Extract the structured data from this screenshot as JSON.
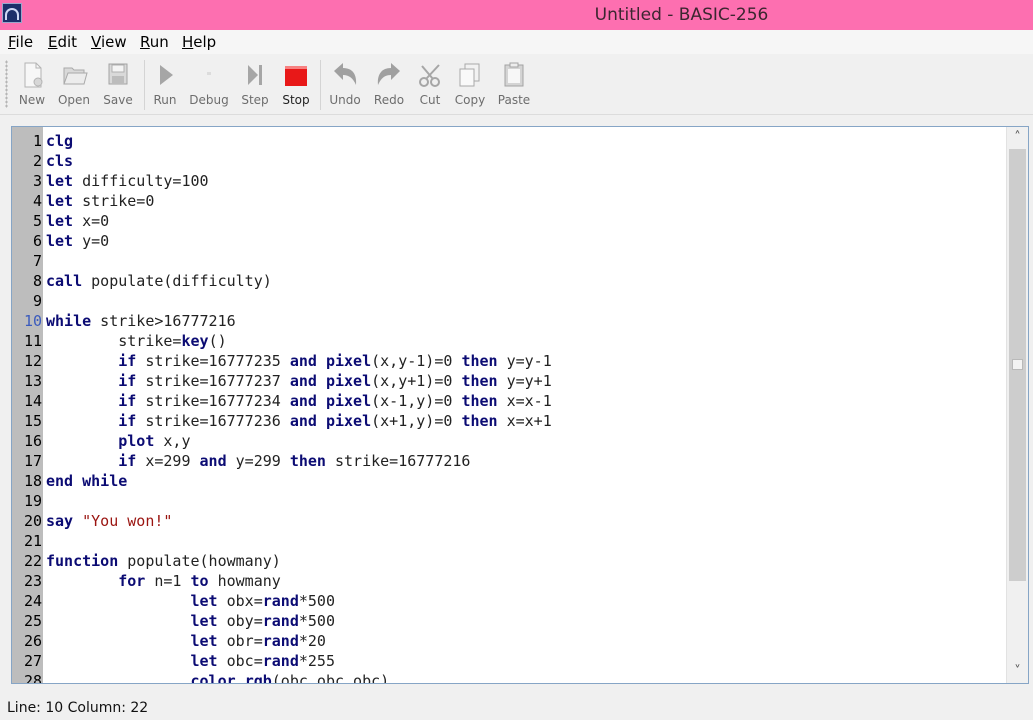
{
  "window": {
    "title": "Untitled - BASIC-256",
    "app_icon": "basic256-icon"
  },
  "menu": [
    {
      "label": "File",
      "key": "F",
      "rest": "ile"
    },
    {
      "label": "Edit",
      "key": "E",
      "rest": "dit"
    },
    {
      "label": "View",
      "key": "V",
      "rest": "iew"
    },
    {
      "label": "Run",
      "key": "R",
      "rest": "un"
    },
    {
      "label": "Help",
      "key": "H",
      "rest": "elp"
    }
  ],
  "toolbar": {
    "new": "New",
    "open": "Open",
    "save": "Save",
    "run": "Run",
    "debug": "Debug",
    "step": "Step",
    "stop": "Stop",
    "undo": "Undo",
    "redo": "Redo",
    "cut": "Cut",
    "copy": "Copy",
    "paste": "Paste"
  },
  "editor": {
    "current_line": 10,
    "lines": [
      {
        "n": "1",
        "text": "<k>clg</k>"
      },
      {
        "n": "2",
        "text": "<k>cls</k>"
      },
      {
        "n": "3",
        "text": "<k>let</k> difficulty=100"
      },
      {
        "n": "4",
        "text": "<k>let</k> strike=0"
      },
      {
        "n": "5",
        "text": "<k>let</k> x=0"
      },
      {
        "n": "6",
        "text": "<k>let</k> y=0"
      },
      {
        "n": "7",
        "text": ""
      },
      {
        "n": "8",
        "text": "<k>call</k> populate(difficulty)"
      },
      {
        "n": "9",
        "text": ""
      },
      {
        "n": "10",
        "text": "<k>while</k> strike<>16777216"
      },
      {
        "n": "11",
        "text": "        strike=<k>key</k>()"
      },
      {
        "n": "12",
        "text": "        <k>if</k> strike=16777235 <k>and</k> <k>pixel</k>(x,y-1)=0 <k>then</k> y=y-1"
      },
      {
        "n": "13",
        "text": "        <k>if</k> strike=16777237 <k>and</k> <k>pixel</k>(x,y+1)=0 <k>then</k> y=y+1"
      },
      {
        "n": "14",
        "text": "        <k>if</k> strike=16777234 <k>and</k> <k>pixel</k>(x-1,y)=0 <k>then</k> x=x-1"
      },
      {
        "n": "15",
        "text": "        <k>if</k> strike=16777236 <k>and</k> <k>pixel</k>(x+1,y)=0 <k>then</k> x=x+1"
      },
      {
        "n": "16",
        "text": "        <k>plot</k> x,y"
      },
      {
        "n": "17",
        "text": "        <k>if</k> x=299 <k>and</k> y=299 <k>then</k> strike=16777216"
      },
      {
        "n": "18",
        "text": "<k>end</k> <k>while</k>"
      },
      {
        "n": "19",
        "text": ""
      },
      {
        "n": "20",
        "text": "<k>say</k> <s>\"You won!\"</s>"
      },
      {
        "n": "21",
        "text": ""
      },
      {
        "n": "22",
        "text": "<k>function</k> populate(howmany)"
      },
      {
        "n": "23",
        "text": "        <k>for</k> n=1 <k>to</k> howmany"
      },
      {
        "n": "24",
        "text": "                <k>let</k> obx=<k>rand</k>*500"
      },
      {
        "n": "25",
        "text": "                <k>let</k> oby=<k>rand</k>*500"
      },
      {
        "n": "26",
        "text": "                <k>let</k> obr=<k>rand</k>*20"
      },
      {
        "n": "27",
        "text": "                <k>let</k> obc=<k>rand</k>*255"
      },
      {
        "n": "28",
        "text": "                <k>color</k> <k>rgb</k>(obc,obc,obc)"
      }
    ]
  },
  "scrollbar": {
    "up": "˄",
    "down": "˅"
  },
  "status": {
    "text": "Line: 10 Column: 22"
  },
  "colors": {
    "titlebar": "#fd6fb0",
    "keyword": "#0b0b73",
    "string": "#9a1410",
    "stop": "#e81818"
  }
}
